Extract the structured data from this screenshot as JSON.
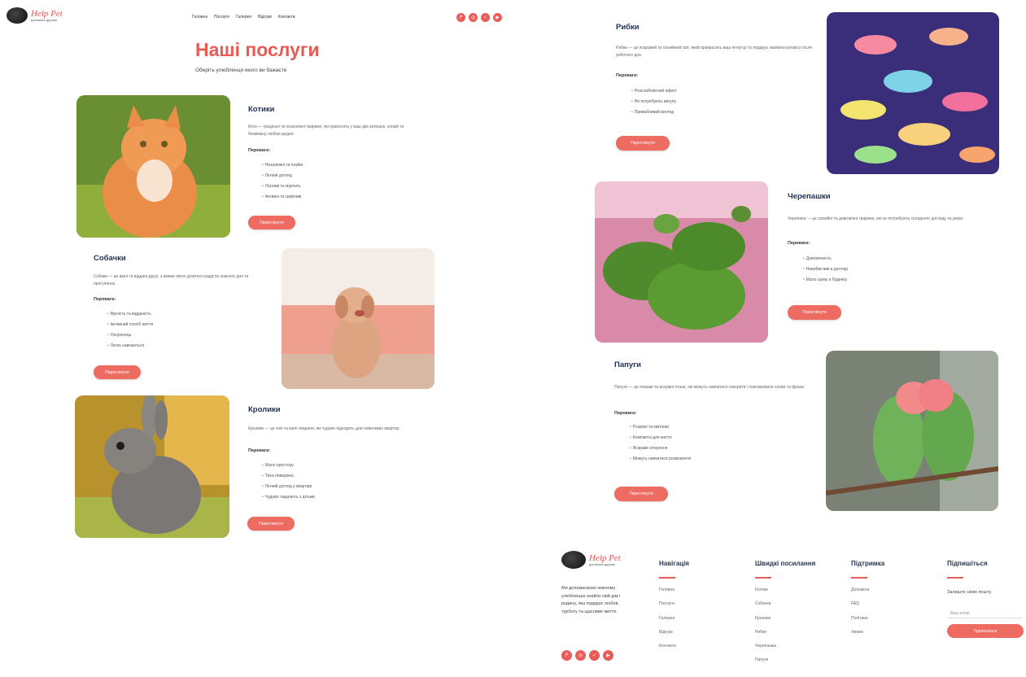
{
  "logo": {
    "title": "Help Pet",
    "subtitle": "допомога друзям"
  },
  "nav": [
    "Головна",
    "Послуги",
    "Галерея",
    "Відгуки",
    "Контакти"
  ],
  "socials": [
    {
      "name": "pinterest",
      "glyph": "P"
    },
    {
      "name": "instagram",
      "glyph": "◎"
    },
    {
      "name": "twitter",
      "glyph": "✓"
    },
    {
      "name": "youtube",
      "glyph": "▶"
    }
  ],
  "page": {
    "title": "Наші послуги",
    "subtitle": "Оберіть улюбленця якого ви бажаєте"
  },
  "services": {
    "cats": {
      "title": "Котики",
      "desc": "Коти — граціозні та незалежні тварини, які приносять у ваш дім затишок, спокій та безмежну любов щодня.",
      "adv_title": "Переваги:",
      "advantages": [
        "Незалежні та охайні",
        "Легкий догляд",
        "Ласкаві та мурчать",
        "Активні та грайливі"
      ],
      "button": "Переглянути"
    },
    "dogs": {
      "title": "Собачки",
      "desc": "Собаки — це вірні та віддані друзі, з якими легко ділитися радістю кожного дня та прогулянок.",
      "adv_title": "Переваги:",
      "advantages": [
        "Вірність та відданість",
        "Активний спосіб життя",
        "Охоронець",
        "Легко навчаються"
      ],
      "button": "Переглянути"
    },
    "rabbits": {
      "title": "Кролики",
      "desc": "Кролики — це тихі та милі тварини, які чудово підходять для невеликих квартир.",
      "adv_title": "Переваги:",
      "advantages": [
        "Мало простору",
        "Тиха поведінка",
        "Легкий догляд у квартирі",
        "Чудово ладнають з дітьми"
      ],
      "button": "Переглянути"
    },
    "fish": {
      "title": "Рибки",
      "desc": "Рибки — це яскравий та спокійний світ, який прикрасить ваш інтер'єр та подарує хвилини релаксу після робочого дня.",
      "adv_title": "Переваги:",
      "advantages": [
        "Розслабляючий ефект",
        "Не потребують вигулу",
        "Привабливий вигляд"
      ],
      "button": "Переглянути"
    },
    "turtles": {
      "title": "Черепашки",
      "desc": "Черепахи — це спокійні та довговічні тварини, які не потребують складного догляду та уваги.",
      "adv_title": "Переваги:",
      "advantages": [
        "Довговічність",
        "Невибагливі в догляді",
        "Мало шуму в будинку"
      ],
      "button": "Переглянути"
    },
    "parrots": {
      "title": "Папуги",
      "desc": "Папуги — це яскраві та розумні птахи, які можуть навчитися говорити і повторювати слова та фрази.",
      "adv_title": "Переваги:",
      "advantages": [
        "Розумні та кмітливі",
        "Компактні для життя",
        "Яскраве оперення",
        "Можуть навчитися розмовляти"
      ],
      "button": "Переглянути"
    }
  },
  "footer": {
    "about": "Ми допомагаємо кожному улюбленцю знайти свій дім і родину, яка подарує любов, турботу та щасливе життя.",
    "columns": [
      {
        "title": "Навігація",
        "links": [
          "Головна",
          "Послуги",
          "Галерея",
          "Відгуки",
          "Контакти"
        ]
      },
      {
        "title": "Швидкі посилання",
        "links": [
          "Котики",
          "Собачки",
          "Кролики",
          "Рибки",
          "Черепашки",
          "Папуги"
        ]
      },
      {
        "title": "Підтримка",
        "links": [
          "Допомога",
          "FAQ",
          "Політика",
          "Умови"
        ]
      }
    ],
    "subscribe": {
      "title": "Підпишіться",
      "text": "Залиште свою пошту",
      "placeholder": "Ваш email",
      "button": "Підписатися"
    }
  }
}
